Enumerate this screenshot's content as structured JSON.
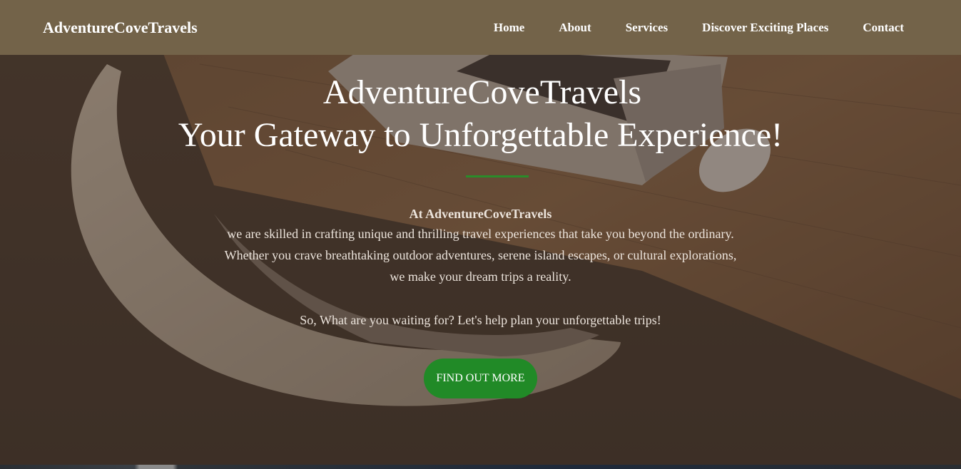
{
  "nav": {
    "brand": "AdventureCoveTravels",
    "links": [
      "Home",
      "About",
      "Services",
      "Discover Exciting Places",
      "Contact"
    ]
  },
  "hero": {
    "title_line1": "AdventureCoveTravels",
    "title_line2": "Your Gateway to Unforgettable Experience!",
    "intro_heading": "At AdventureCoveTravels",
    "intro_lines": [
      "we are skilled in crafting unique and thrilling travel experiences that take you beyond the ordinary.",
      "Whether you crave breathtaking outdoor adventures, serene island escapes, or cultural explorations,",
      "we make your dream trips a reality."
    ],
    "cta_text": "So, What are you waiting for? Let's help plan your unforgettable trips!",
    "cta_button": "FIND OUT MORE"
  },
  "colors": {
    "navbar": "#736349",
    "accent_green": "#218a27",
    "divider_green": "#2a8c2a"
  }
}
